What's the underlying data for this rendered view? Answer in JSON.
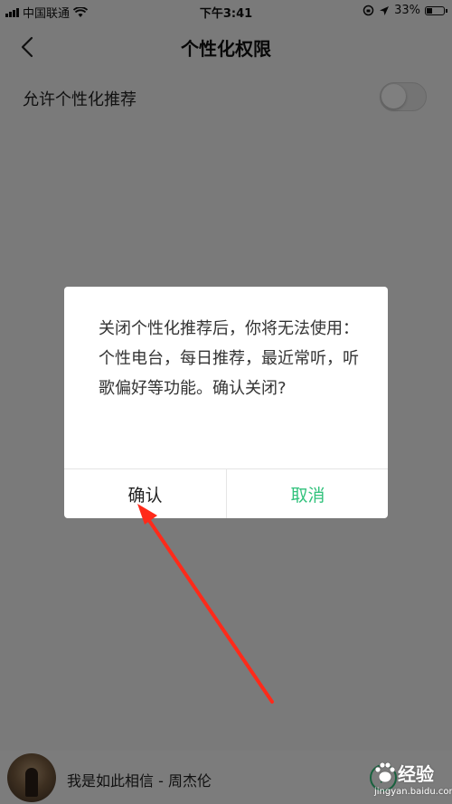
{
  "status_bar": {
    "carrier": "中国联通",
    "time": "下午3:41",
    "battery_percent": "33%",
    "battery_level": 0.33
  },
  "nav": {
    "title": "个性化权限"
  },
  "setting": {
    "label": "允许个性化推荐",
    "enabled": false
  },
  "dialog": {
    "message": "关闭个性化推荐后，你将无法使用：个性电台，每日推荐，最近常听，听歌偏好等功能。确认关闭?",
    "confirm_label": "确认",
    "cancel_label": "取消"
  },
  "mini_player": {
    "song": "我是如此相信 - 周杰伦"
  },
  "watermark": {
    "text": "经验",
    "url": "jingyan.baidu.com"
  },
  "colors": {
    "accent": "#31c27c",
    "annotation": "#ff2a1a"
  }
}
